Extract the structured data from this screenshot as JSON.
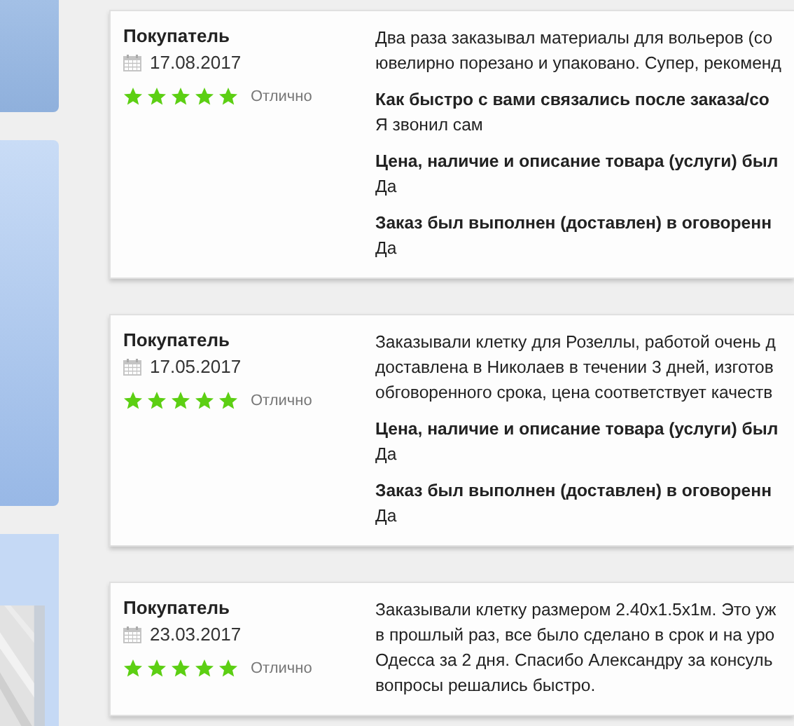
{
  "reviews": [
    {
      "author": "Покупатель",
      "date": "17.08.2017",
      "stars": 5,
      "rating_label": "Отлично",
      "text_lines": [
        "Два раза заказывал материалы для вольеров (со",
        "ювелирно порезано и упаковано. Супер, рекоменд"
      ],
      "answers": [
        {
          "question": "Как быстро с вами связались после заказа/со",
          "answer": "Я звонил сам"
        },
        {
          "question": "Цена, наличие и описание товара (услуги) был",
          "answer": "Да"
        },
        {
          "question": "Заказ был выполнен (доставлен) в оговоренн",
          "answer": "Да"
        }
      ]
    },
    {
      "author": "Покупатель",
      "date": "17.05.2017",
      "stars": 5,
      "rating_label": "Отлично",
      "text_lines": [
        "Заказывали клетку для Розеллы, работой очень д",
        "доставлена в Николаев в течении 3 дней, изготов",
        "обговоренного срока, цена соответствует качеств"
      ],
      "answers": [
        {
          "question": "Цена, наличие и описание товара (услуги) был",
          "answer": "Да"
        },
        {
          "question": "Заказ был выполнен (доставлен) в оговоренн",
          "answer": "Да"
        }
      ]
    },
    {
      "author": "Покупатель",
      "date": "23.03.2017",
      "stars": 5,
      "rating_label": "Отлично",
      "text_lines": [
        "Заказывали клетку размером 2.40x1.5x1м. Это уж",
        "в прошлый раз, все было сделано в срок и на уро",
        "Одесса за 2 дня. Спасибо Александру за консуль",
        "вопросы решались быстро."
      ]
    }
  ]
}
